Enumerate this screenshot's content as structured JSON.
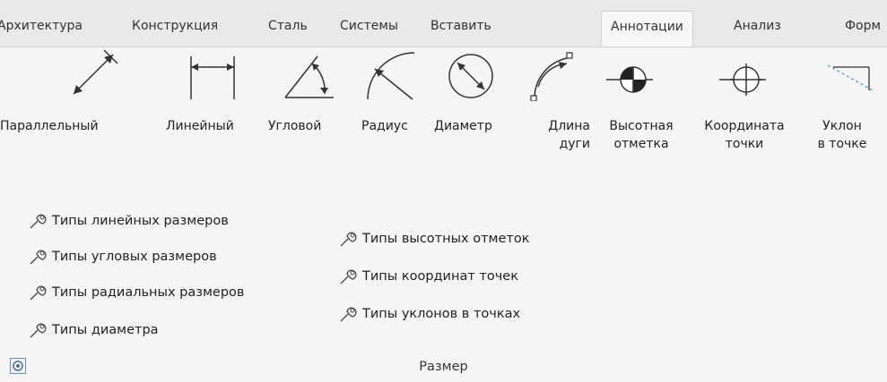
{
  "tabs": [
    "Архитектура",
    "Конструкция",
    "Сталь",
    "Системы",
    "Вставить",
    "Аннотации",
    "Анализ",
    "Форм"
  ],
  "active_tab": "Аннотации",
  "tools": [
    {
      "line1": "Параллельный",
      "line2": "",
      "icon": "aligned-dimension-icon"
    },
    {
      "line1": "Линейный",
      "line2": "",
      "icon": "linear-dimension-icon"
    },
    {
      "line1": "Угловой",
      "line2": "",
      "icon": "angular-dimension-icon"
    },
    {
      "line1": "Радиус",
      "line2": "",
      "icon": "radius-dimension-icon"
    },
    {
      "line1": "Диаметр",
      "line2": "",
      "icon": "diameter-dimension-icon"
    },
    {
      "line1": "Длина",
      "line2": "дуги",
      "icon": "arc-length-icon"
    },
    {
      "line1": "Высотная",
      "line2": "отметка",
      "icon": "spot-elevation-icon"
    },
    {
      "line1": "Координата",
      "line2": "точки",
      "icon": "spot-coordinate-icon"
    },
    {
      "line1": "Уклон",
      "line2": "в точке",
      "icon": "spot-slope-icon"
    }
  ],
  "types_left": [
    "Типы линейных размеров",
    "Типы угловых размеров",
    "Типы радиальных размеров",
    "Типы диаметра"
  ],
  "types_right": [
    "Типы высотных отметок",
    "Типы координат точек",
    "Типы уклонов в точках"
  ],
  "group_title": "Размер"
}
